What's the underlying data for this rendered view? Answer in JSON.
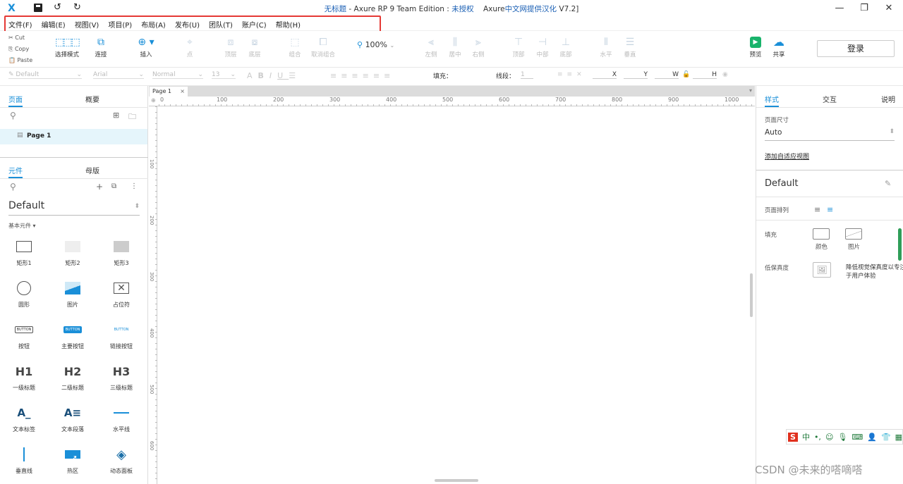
{
  "titlebar": {
    "app_icon": "axure-logo-icon",
    "title_blue": "无标题",
    "title_mid": " - Axure RP 9 Team Edition : ",
    "title_unlicensed": "未授权",
    "title_tail_a": "    Axure",
    "title_tail_b": "中文网提供汉化",
    "title_tail_c": " V7.2]",
    "minimize": "—",
    "restore": "❐",
    "close": "✕"
  },
  "menu": {
    "file": "文件(F)",
    "edit": "编辑(E)",
    "view": "视图(V)",
    "project": "项目(P)",
    "layout": "布局(A)",
    "publish": "发布(U)",
    "team": "团队(T)",
    "account": "账户(C)",
    "help": "帮助(H)"
  },
  "clipboard": {
    "cut": "Cut",
    "copy": "Copy",
    "paste": "Paste"
  },
  "toolbar": {
    "select_mode": "选择模式",
    "connect": "连接",
    "insert": "插入",
    "point": "点",
    "top_layer": "顶层",
    "bottom_layer": "底层",
    "group": "组合",
    "ungroup": "取消组合",
    "zoom": "100%",
    "align_left": "左侧",
    "align_center": "居中",
    "align_right": "右侧",
    "align_top": "顶部",
    "align_middle": "中部",
    "align_bottom": "底部",
    "dist_horizontal": "水平",
    "dist_vertical": "垂直",
    "preview": "预览",
    "share": "共享",
    "login": "登录"
  },
  "format": {
    "style": "Default",
    "font": "Arial",
    "weight": "Normal",
    "size": "13",
    "fill_label": "填充：",
    "line_label": "线段：",
    "line_value": "1",
    "x": "X",
    "y": "Y",
    "w": "W",
    "h": "H"
  },
  "left": {
    "pages_tab": "页面",
    "outline_tab": "概要",
    "page1": "Page 1",
    "widgets_tab": "元件",
    "masters_tab": "母版",
    "library": "Default",
    "section": "基本元件 ▾",
    "widgets": [
      {
        "label": "矩形1"
      },
      {
        "label": "矩形2"
      },
      {
        "label": "矩形3"
      },
      {
        "label": "圆形"
      },
      {
        "label": "图片"
      },
      {
        "label": "占位符"
      },
      {
        "label": "按钮",
        "text": "BUTTON"
      },
      {
        "label": "主要按钮",
        "text": "BUTTON"
      },
      {
        "label": "链接按钮",
        "text": "BUTTON"
      },
      {
        "label": "一级标题",
        "text": "H1"
      },
      {
        "label": "二级标题",
        "text": "H2"
      },
      {
        "label": "三级标题",
        "text": "H3"
      },
      {
        "label": "文本标签",
        "text": "A_"
      },
      {
        "label": "文本段落",
        "text": "A≡"
      },
      {
        "label": "水平线"
      },
      {
        "label": "垂直线"
      },
      {
        "label": "热区"
      },
      {
        "label": "动态面板"
      }
    ]
  },
  "canvas": {
    "tab": "Page 1",
    "tab_close": "×",
    "hruler": [
      "0",
      "100",
      "200",
      "300",
      "400",
      "500",
      "600",
      "700",
      "800",
      "900",
      "1000"
    ],
    "vruler": [
      "100",
      "200",
      "300",
      "400",
      "500",
      "600"
    ]
  },
  "right": {
    "style_tab": "样式",
    "interact_tab": "交互",
    "notes_tab": "说明",
    "page_size_label": "页面尺寸",
    "page_size": "Auto",
    "add_adaptive": "添加自适应视图",
    "style_name": "Default",
    "page_align": "页面排列",
    "fill": "填充",
    "fill_color": "颜色",
    "fill_image": "图片",
    "low_fidelity": "低保真度",
    "low_fidelity_desc_1": "降低视觉保真度以专注",
    "low_fidelity_desc_2": "于用户体验"
  },
  "ime": {
    "s": "S",
    "zh": "中",
    "dot": "•,"
  },
  "watermark": "CSDN @未来的嗒嘀嗒",
  "colors": {
    "accent": "#1a8fd8",
    "highlight": "#e53935",
    "preview": "#19b36b"
  }
}
